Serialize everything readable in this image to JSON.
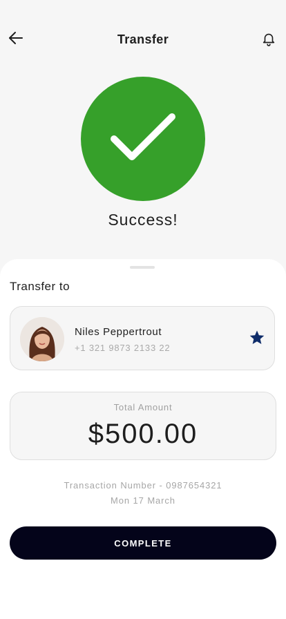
{
  "header": {
    "title": "Transfer",
    "back_icon": "arrow-left-icon",
    "notification_icon": "bell-icon"
  },
  "status": {
    "icon": "checkmark-icon",
    "message": "Success!",
    "color": "#36a02a"
  },
  "transfer": {
    "section_title": "Transfer to",
    "recipient": {
      "name": "Niles Peppertrout",
      "phone": "+1 321 9873 2133 22",
      "favorite_icon": "star-icon",
      "favorite_color": "#0f2d6a"
    },
    "amount": {
      "label": "Total Amount",
      "value": "$500.00"
    },
    "transaction_number": "Transaction Number - 0987654321",
    "date": "Mon 17 March"
  },
  "actions": {
    "complete_label": "COMPLETE",
    "button_color": "#04041a"
  }
}
